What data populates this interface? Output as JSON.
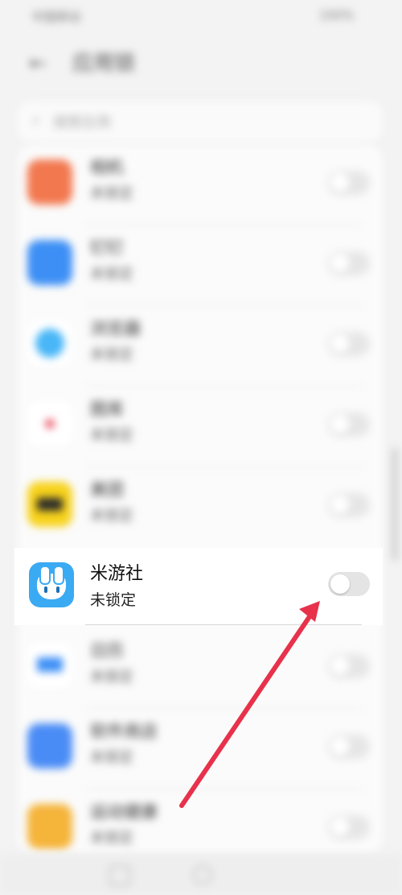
{
  "statusbar": {
    "left": "中国移动",
    "right": "100%"
  },
  "header": {
    "title": "应用锁"
  },
  "search": {
    "placeholder": "搜索应用"
  },
  "apps": [
    {
      "name": "相机",
      "status": "未锁定",
      "color": "#f2784f"
    },
    {
      "name": "钉钉",
      "status": "未锁定",
      "color": "#3d8ff5"
    },
    {
      "name": "浏览器",
      "status": "未锁定",
      "color": "#48b6f7"
    },
    {
      "name": "图库",
      "status": "未锁定",
      "color": "#ffffff"
    },
    {
      "name": "美团",
      "status": "未锁定",
      "color": "#f7d21b"
    },
    {
      "name": "米游社",
      "status": "未锁定",
      "color": "#3aaaf3",
      "toggle": false
    },
    {
      "name": "日历",
      "status": "未锁定",
      "color": "#3d8ff5"
    },
    {
      "name": "软件商店",
      "status": "未锁定",
      "color": "#4a8cf5"
    },
    {
      "name": "运动健康",
      "status": "未锁定",
      "color": "#f5b43a"
    }
  ],
  "annotation": {
    "arrow_color": "#e8314b"
  }
}
